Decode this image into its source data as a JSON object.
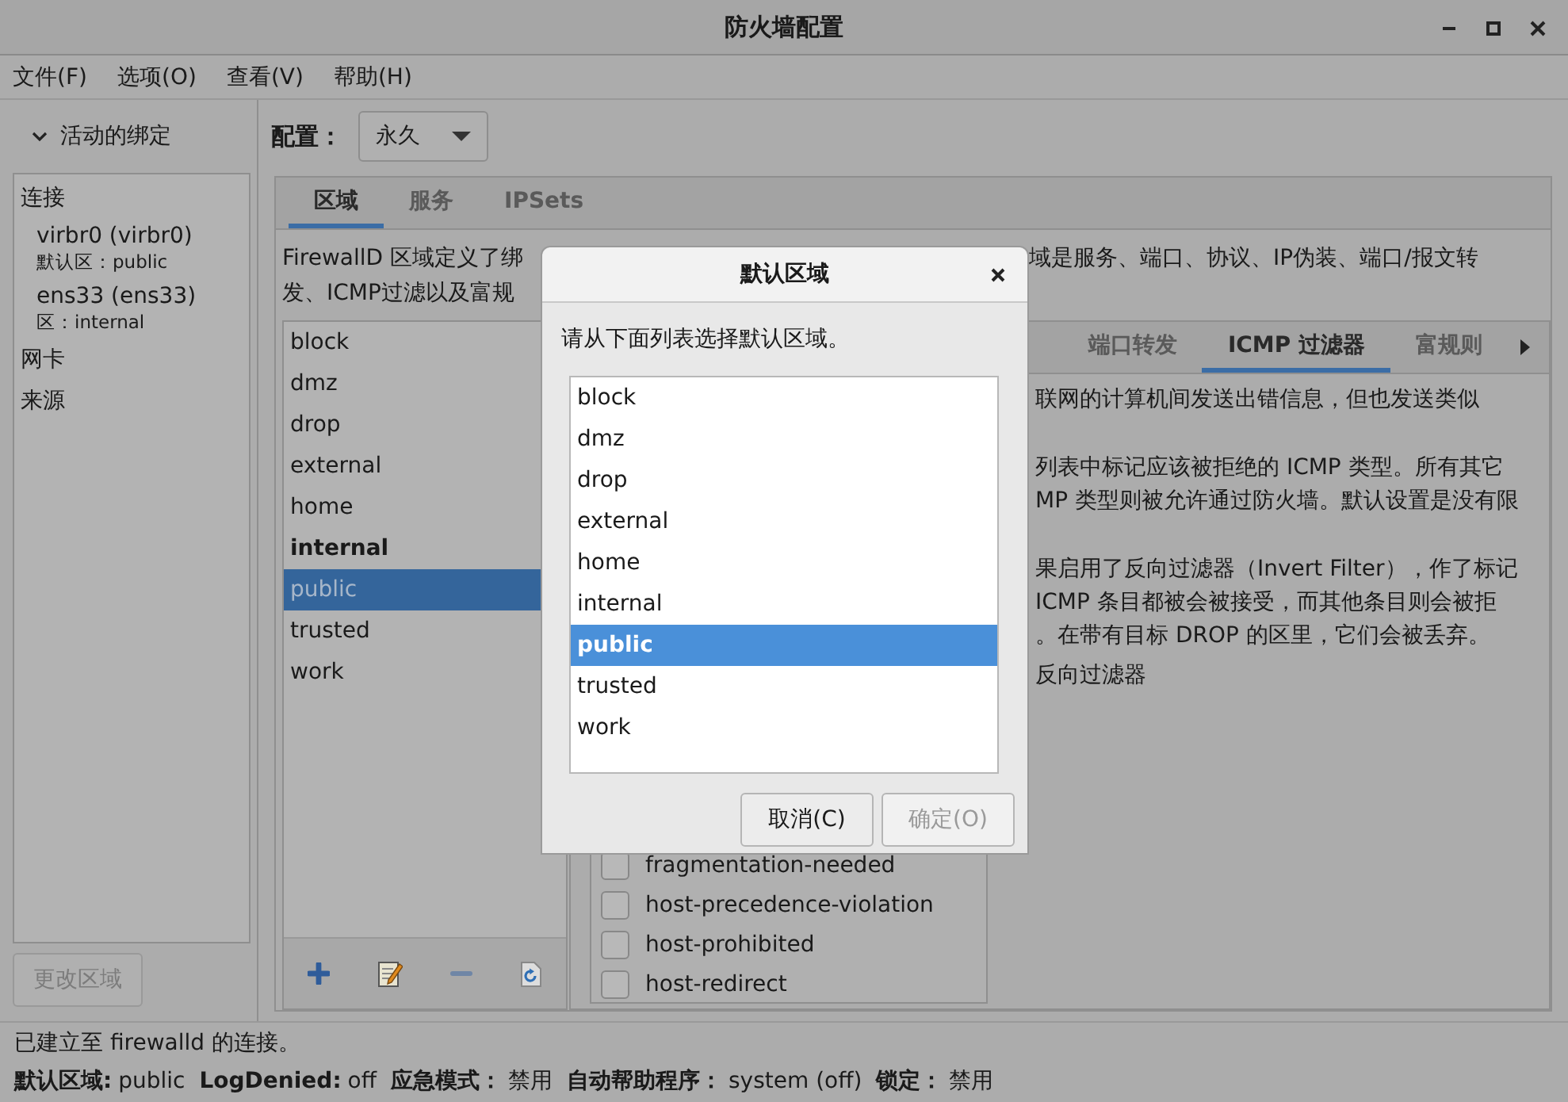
{
  "window": {
    "title": "防火墙配置"
  },
  "menu": [
    "文件(F)",
    "选项(O)",
    "查看(V)",
    "帮助(H)"
  ],
  "sidebar": {
    "header": "活动的绑定",
    "expanded": true,
    "items": [
      {
        "kind": "heading",
        "text": "连接"
      },
      {
        "kind": "binding",
        "name": "virbr0 (virbr0)",
        "zone": "默认区：public"
      },
      {
        "kind": "binding",
        "name": "ens33 (ens33)",
        "zone": "区：internal"
      },
      {
        "kind": "heading",
        "text": "网卡"
      },
      {
        "kind": "heading",
        "text": "来源"
      }
    ],
    "button": {
      "label": "更改区域",
      "disabled": true
    }
  },
  "config": {
    "label": "配置：",
    "value": "永久"
  },
  "tabs": [
    {
      "label": "区域",
      "selected": true
    },
    {
      "label": "服务",
      "selected": false
    },
    {
      "label": "IPSets",
      "selected": false
    }
  ],
  "description": [
    {
      "left": "FirewallD 区域定义了绑",
      "right": "域是服务、端口、协议、IP伪装、端口/报文转"
    },
    {
      "left": "发、ICMP过滤以及富规"
    }
  ],
  "zones": [
    {
      "name": "block",
      "is_default": false,
      "selected": false
    },
    {
      "name": "dmz",
      "is_default": false,
      "selected": false
    },
    {
      "name": "drop",
      "is_default": false,
      "selected": false
    },
    {
      "name": "external",
      "is_default": false,
      "selected": false
    },
    {
      "name": "home",
      "is_default": false,
      "selected": false
    },
    {
      "name": "internal",
      "is_default": true,
      "selected": false
    },
    {
      "name": "public",
      "is_default": false,
      "selected": true
    },
    {
      "name": "trusted",
      "is_default": false,
      "selected": false
    },
    {
      "name": "work",
      "is_default": false,
      "selected": false
    }
  ],
  "zone_tabs": [
    {
      "label": "端口转发",
      "selected": false
    },
    {
      "label": "ICMP 过滤器",
      "selected": true
    },
    {
      "label": "富规则",
      "selected": false
    }
  ],
  "icmp_text": [
    [
      "联网的计算机间发送出错信息，但也发送类似"
    ],
    [
      "列表中标记应该被拒绝的 ICMP 类型。所有其它",
      "MP 类型则被允许通过防火墙。默认设置是没有限"
    ],
    [
      "果启用了反向过滤器（Invert Filter），作了标记",
      "ICMP 条目都被会被接受，而其他条目则会被拒",
      "。在带有目标 DROP 的区里，它们会被丢弃。"
    ]
  ],
  "invert_filter": {
    "label": "反向过滤器"
  },
  "icmp_types": [
    {
      "name": "fragmentation-needed",
      "checked": false
    },
    {
      "name": "host-precedence-violation",
      "checked": false
    },
    {
      "name": "host-prohibited",
      "checked": false
    },
    {
      "name": "host-redirect",
      "checked": false
    }
  ],
  "dialog": {
    "title": "默认区域",
    "prompt": "请从下面列表选择默认区域。",
    "items": [
      {
        "name": "block",
        "selected": false
      },
      {
        "name": "dmz",
        "selected": false
      },
      {
        "name": "drop",
        "selected": false
      },
      {
        "name": "external",
        "selected": false
      },
      {
        "name": "home",
        "selected": false
      },
      {
        "name": "internal",
        "selected": false
      },
      {
        "name": "public",
        "selected": true
      },
      {
        "name": "trusted",
        "selected": false
      },
      {
        "name": "work",
        "selected": false
      }
    ],
    "buttons": [
      {
        "label": "取消(C)",
        "disabled": false
      },
      {
        "label": "确定(O)",
        "disabled": true
      }
    ]
  },
  "status": {
    "message": "已建立至  firewalld 的连接。",
    "fields": [
      {
        "label": "默认区域:",
        "value": "public"
      },
      {
        "label": "LogDenied:",
        "value": "off"
      },
      {
        "label": "应急模式：",
        "value": "禁用"
      },
      {
        "label": "自动帮助程序：",
        "value": "system (off)"
      },
      {
        "label": "锁定：",
        "value": "禁用"
      }
    ]
  }
}
